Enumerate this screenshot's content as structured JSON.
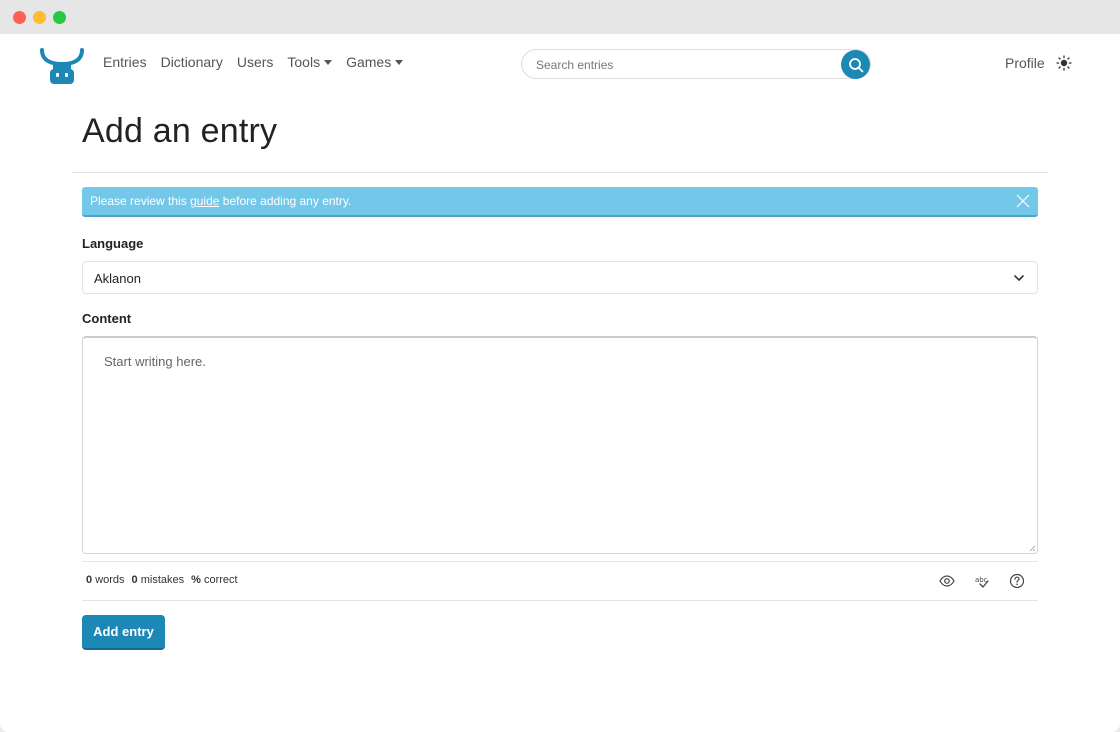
{
  "nav": {
    "links": [
      "Entries",
      "Dictionary",
      "Users"
    ],
    "dropdowns": [
      "Tools",
      "Games"
    ],
    "profile": "Profile"
  },
  "search": {
    "placeholder": "Search entries",
    "value": ""
  },
  "page": {
    "title": "Add an entry"
  },
  "alert": {
    "text_before": "Please review this ",
    "link": "guide",
    "text_after": " before adding any entry."
  },
  "form": {
    "language_label": "Language",
    "language_value": "Aklanon",
    "content_label": "Content",
    "content_placeholder": "Start writing here."
  },
  "stats": {
    "words_count": "0",
    "words_label": "words",
    "mistakes_count": "0",
    "mistakes_label": "mistakes",
    "percent_symbol": "%",
    "percent_label": "correct"
  },
  "actions": {
    "submit_label": "Add entry"
  },
  "colors": {
    "accent": "#1b88b5",
    "alert_bg": "#73c8ea"
  },
  "icons": {
    "logo": "ox-head-logo-icon",
    "search": "search-icon",
    "theme": "sun-icon",
    "close": "close-icon",
    "chevron": "chevron-down-icon",
    "preview": "eye-icon",
    "spellcheck": "spellcheck-icon",
    "help": "help-icon"
  }
}
